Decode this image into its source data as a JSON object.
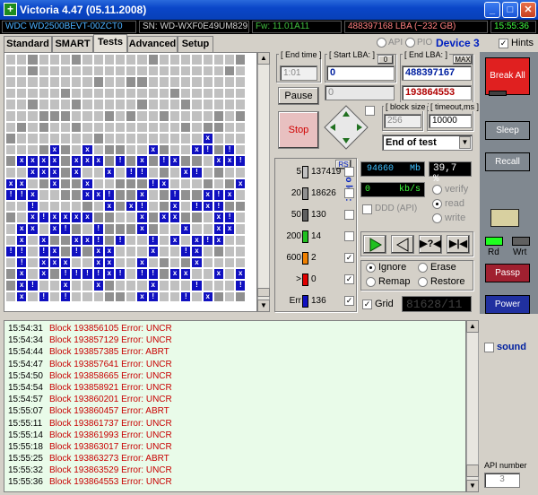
{
  "window": {
    "title": "Victoria 4.47 (05.11.2008)",
    "app_icon": "plus-icon",
    "buttons": [
      "minimize",
      "maximize",
      "close"
    ]
  },
  "infobar": {
    "model": "WDC WD2500BEVT-00ZCT0",
    "serial": "SN:  WD-WXF0E49UM829",
    "firmware": "Fw: 11.01A11",
    "lba": "488397168 LBA (~232 GB)",
    "clock": "15:55:36"
  },
  "tabs": [
    "Standard",
    "SMART",
    "Tests",
    "Advanced",
    "Setup"
  ],
  "active_tab": "Tests",
  "mode": {
    "api": "API",
    "pio": "PIO",
    "device": "Device 3",
    "hints_label": "Hints",
    "hints_checked": true
  },
  "scan": {
    "end_time_label": "[ End time ]",
    "end_time_value": "1:01",
    "start_lba_label": "[ Start LBA: ]",
    "start_lba_reset": "0",
    "start_lba_value": "0",
    "start_lba_current": "0",
    "end_lba_label": "[ End LBA: ]",
    "end_lba_max": "MAX",
    "end_lba_value": "488397167",
    "end_lba_current": "193864553",
    "pause_label": "Pause",
    "stop_label": "Stop",
    "block_size_label": "[ block size ]",
    "block_size_value": "256",
    "timeout_label": "[ timeout,ms ]",
    "timeout_value": "10000",
    "end_action": "End of test"
  },
  "stats": {
    "rs_label": "RS",
    "to_log_label": "to log:",
    "rows": [
      {
        "threshold": "5",
        "count": "137419",
        "color": "#c0c0c0",
        "log": false
      },
      {
        "threshold": "20",
        "count": "18626",
        "color": "#909090",
        "log": false
      },
      {
        "threshold": "50",
        "count": "130",
        "color": "#606060",
        "log": false
      },
      {
        "threshold": "200",
        "count": "14",
        "color": "#20c020",
        "log": false
      },
      {
        "threshold": "600",
        "count": "2",
        "color": "#f08000",
        "log": true
      },
      {
        "threshold": ">",
        "count": "0",
        "color": "#e00000",
        "log": true
      },
      {
        "threshold": "Err",
        "count": "136",
        "color": "#1010c0",
        "log": true
      }
    ]
  },
  "progress": {
    "mb": "94660",
    "mb_unit": "Mb",
    "percent": "39,7 %",
    "speed": "0",
    "speed_unit": "kb/s",
    "ddd_label": "DDD (API)",
    "verify": "verify",
    "read": "read",
    "write": "write",
    "lba_readout": "81628/11"
  },
  "error_action": {
    "ignore": "Ignore",
    "erase": "Erase",
    "remap": "Remap",
    "restore": "Restore",
    "selected": "Ignore",
    "grid_label": "Grid",
    "grid_checked": true
  },
  "right": {
    "break_all": "Break All",
    "sleep": "Sleep",
    "recall": "Recall",
    "rd": "Rd",
    "wrt": "Wrt",
    "passp": "Passp",
    "power": "Power",
    "sound": "sound",
    "api_number_label": "API number",
    "api_number": "3"
  },
  "log": [
    {
      "time": "15:54:31",
      "msg": "Block 193856105 Error: UNCR"
    },
    {
      "time": "15:54:34",
      "msg": "Block 193857129 Error: UNCR"
    },
    {
      "time": "15:54:44",
      "msg": "Block 193857385 Error: ABRT"
    },
    {
      "time": "15:54:47",
      "msg": "Block 193857641 Error: UNCR"
    },
    {
      "time": "15:54:50",
      "msg": "Block 193858665 Error: UNCR"
    },
    {
      "time": "15:54:54",
      "msg": "Block 193858921 Error: UNCR"
    },
    {
      "time": "15:54:57",
      "msg": "Block 193860201 Error: UNCR"
    },
    {
      "time": "15:55:07",
      "msg": "Block 193860457 Error: ABRT"
    },
    {
      "time": "15:55:11",
      "msg": "Block 193861737 Error: UNCR"
    },
    {
      "time": "15:55:14",
      "msg": "Block 193861993 Error: UNCR"
    },
    {
      "time": "15:55:18",
      "msg": "Block 193863017 Error: UNCR"
    },
    {
      "time": "15:55:25",
      "msg": "Block 193863273 Error: ABRT"
    },
    {
      "time": "15:55:32",
      "msg": "Block 193863529 Error: UNCR"
    },
    {
      "time": "15:55:36",
      "msg": "Block 193864553 Error: UNCR"
    }
  ],
  "colors": {
    "err_block": "#1010c0",
    "gray_block": "#c0c0c0",
    "dark_block": "#909090",
    "log_bg": "#e9fbe9",
    "log_text": "#c80000"
  }
}
